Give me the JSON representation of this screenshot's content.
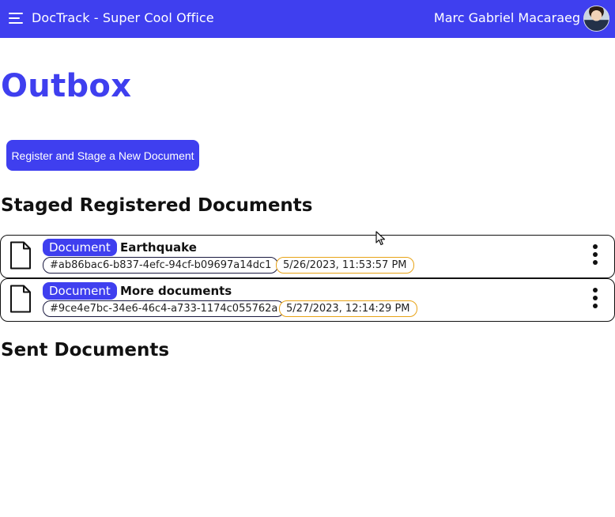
{
  "header": {
    "app_title": "DocTrack - Super Cool Office",
    "user_name": "Marc Gabriel Macaraeg",
    "menu_icon": "hamburger-menu-icon",
    "avatar_icon": "user-avatar"
  },
  "page": {
    "title": "Outbox",
    "register_button": "Register and Stage a New Document"
  },
  "staged": {
    "title": "Staged Registered Documents",
    "items": [
      {
        "tag": "Document",
        "name": "Earthquake",
        "id": "#ab86bac6-b837-4efc-94cf-b09697a14dc1",
        "date": "5/26/2023, 11:53:57 PM"
      },
      {
        "tag": "Document",
        "name": "More documents",
        "id": "#9ce4e7bc-34e6-46c4-a733-1174c055762a",
        "date": "5/27/2023, 12:14:29 PM"
      }
    ]
  },
  "sent": {
    "title": "Sent Documents"
  },
  "colors": {
    "primary": "#3f3fef",
    "date_border": "#e8a317",
    "id_border": "#1a1a40"
  }
}
